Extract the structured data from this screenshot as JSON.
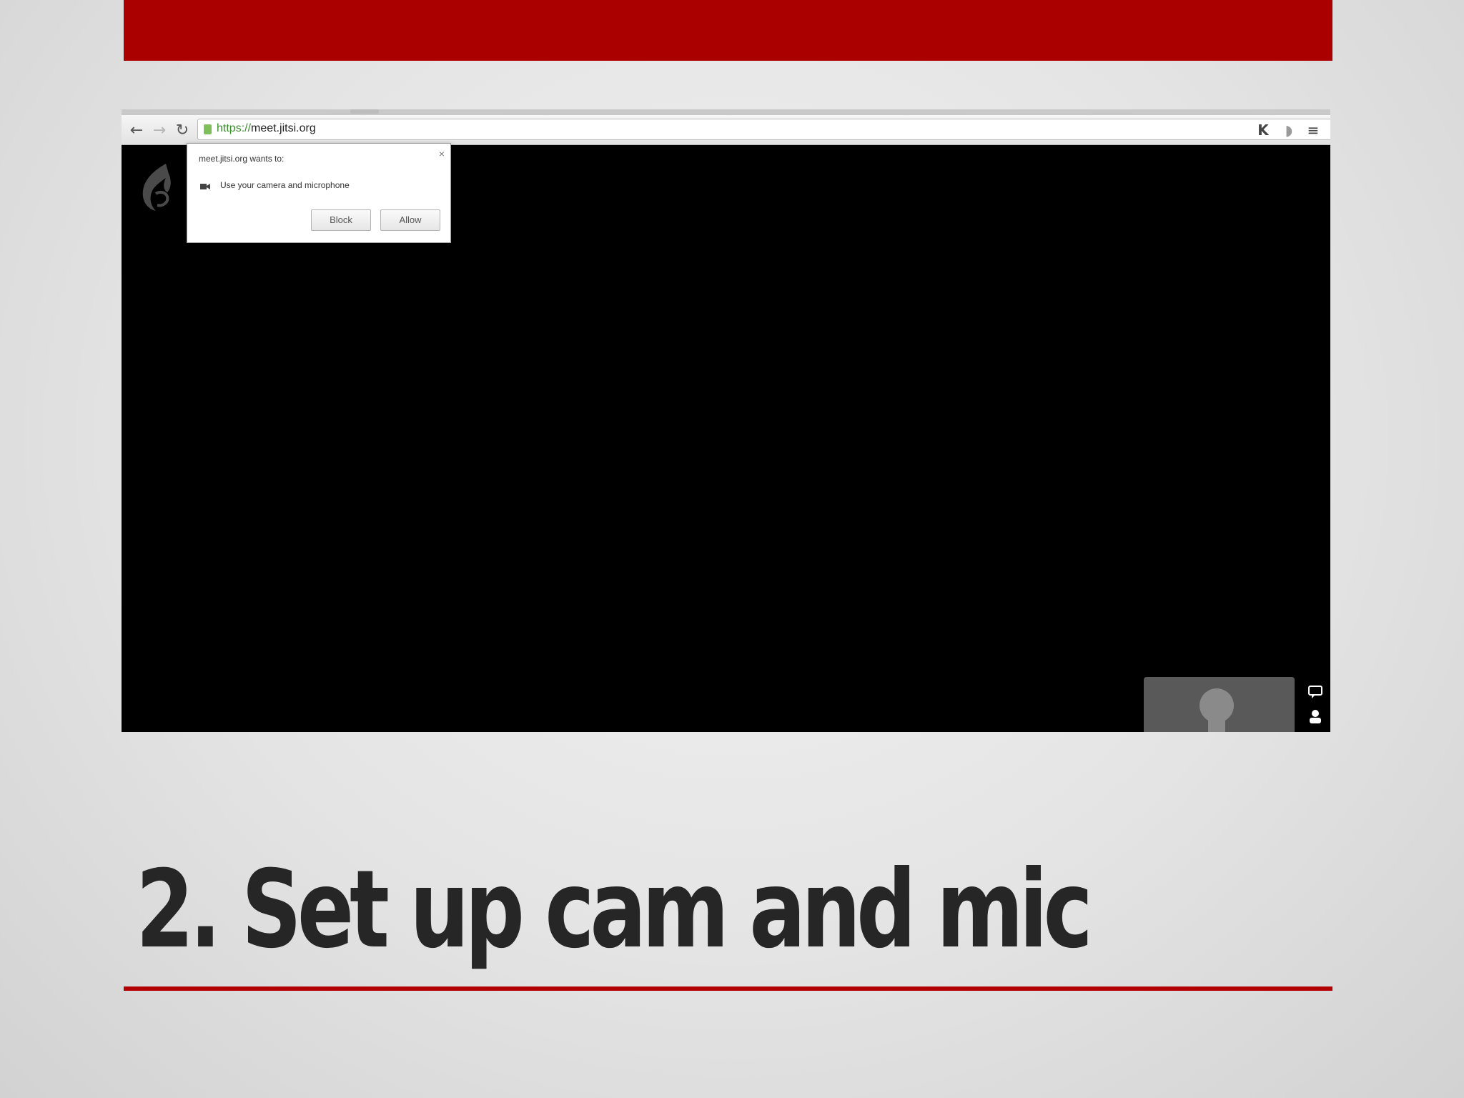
{
  "slide": {
    "title": "2. Set up cam and mic",
    "accent_color": "#ab0000",
    "title_color": "#262626"
  },
  "browser": {
    "url_scheme": "https://",
    "url_host": "meet.jitsi.org",
    "nav_icons": [
      "back-arrow-icon",
      "forward-arrow-icon",
      "reload-icon"
    ],
    "toolbar_icons": [
      "bookmark-star-icon",
      "extension-k-icon",
      "extension-icon",
      "menu-icon"
    ]
  },
  "permission_popup": {
    "title": "meet.jitsi.org wants to:",
    "request": "Use your camera and microphone",
    "block_label": "Block",
    "allow_label": "Allow",
    "close_glyph": "×"
  },
  "app": {
    "logo": "jitsi-logo",
    "side_icons": [
      "chat-icon",
      "contact-list-icon"
    ]
  }
}
